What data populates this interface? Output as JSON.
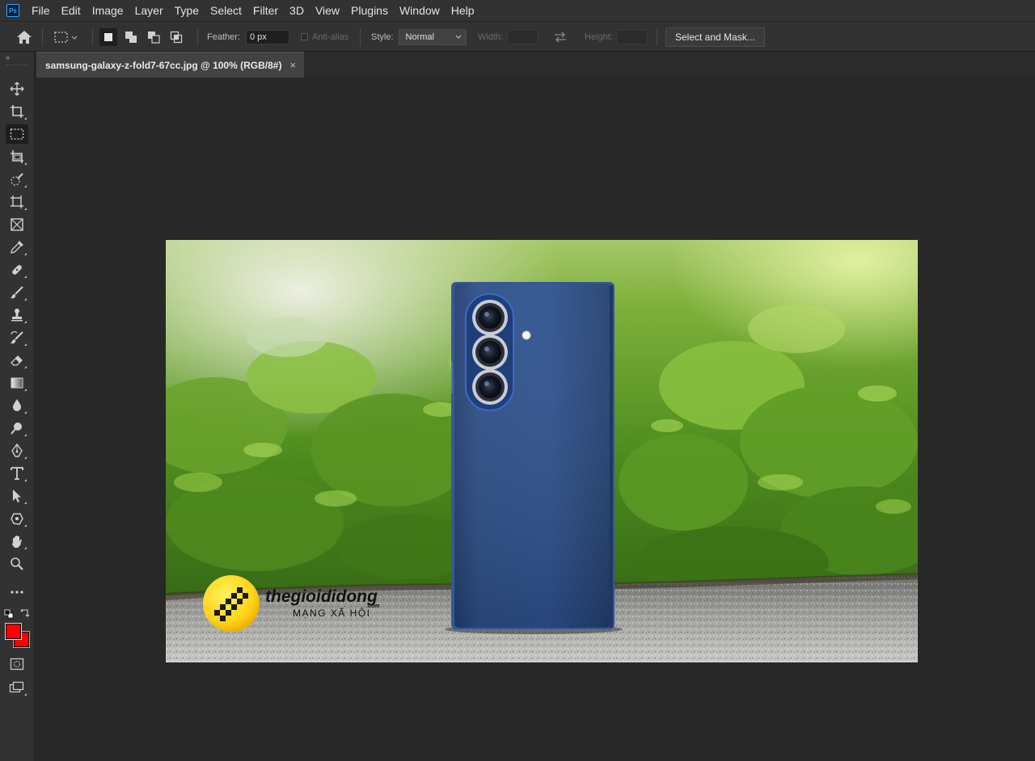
{
  "app": {
    "logo_text": "Ps"
  },
  "menu": [
    "File",
    "Edit",
    "Image",
    "Layer",
    "Type",
    "Select",
    "Filter",
    "3D",
    "View",
    "Plugins",
    "Window",
    "Help"
  ],
  "options": {
    "feather_label": "Feather:",
    "feather_value": "0 px",
    "anti_alias_label": "Anti-alias",
    "style_label": "Style:",
    "style_value": "Normal",
    "width_label": "Width:",
    "height_label": "Height:",
    "select_mask_label": "Select and Mask..."
  },
  "document": {
    "tab_title": "samsung-galaxy-z-fold7-67cc.jpg @ 100% (RGB/8#)",
    "close_glyph": "×"
  },
  "photo": {
    "watermark_brand": "thegioididong",
    "watermark_dotcom": ".com",
    "watermark_sub": "MẠNG XÃ HỘI",
    "phone_color": "#2c4e86"
  },
  "colors": {
    "foreground": "#ff0000",
    "background": "#ff0000",
    "accent": "#31a8ff"
  },
  "tools": [
    "move-icon",
    "crop-icon",
    "marquee-icon",
    "frame-crop-icon",
    "quick-select-icon",
    "transform-icon",
    "frame-icon",
    "eyedropper-icon",
    "healing-icon",
    "brush-icon",
    "stamp-icon",
    "history-brush-icon",
    "eraser-icon",
    "gradient-icon",
    "blur-icon",
    "dodge-icon",
    "pen-icon",
    "type-icon",
    "path-select-icon",
    "shape-icon",
    "hand-icon",
    "zoom-icon",
    "more-tools-icon"
  ]
}
